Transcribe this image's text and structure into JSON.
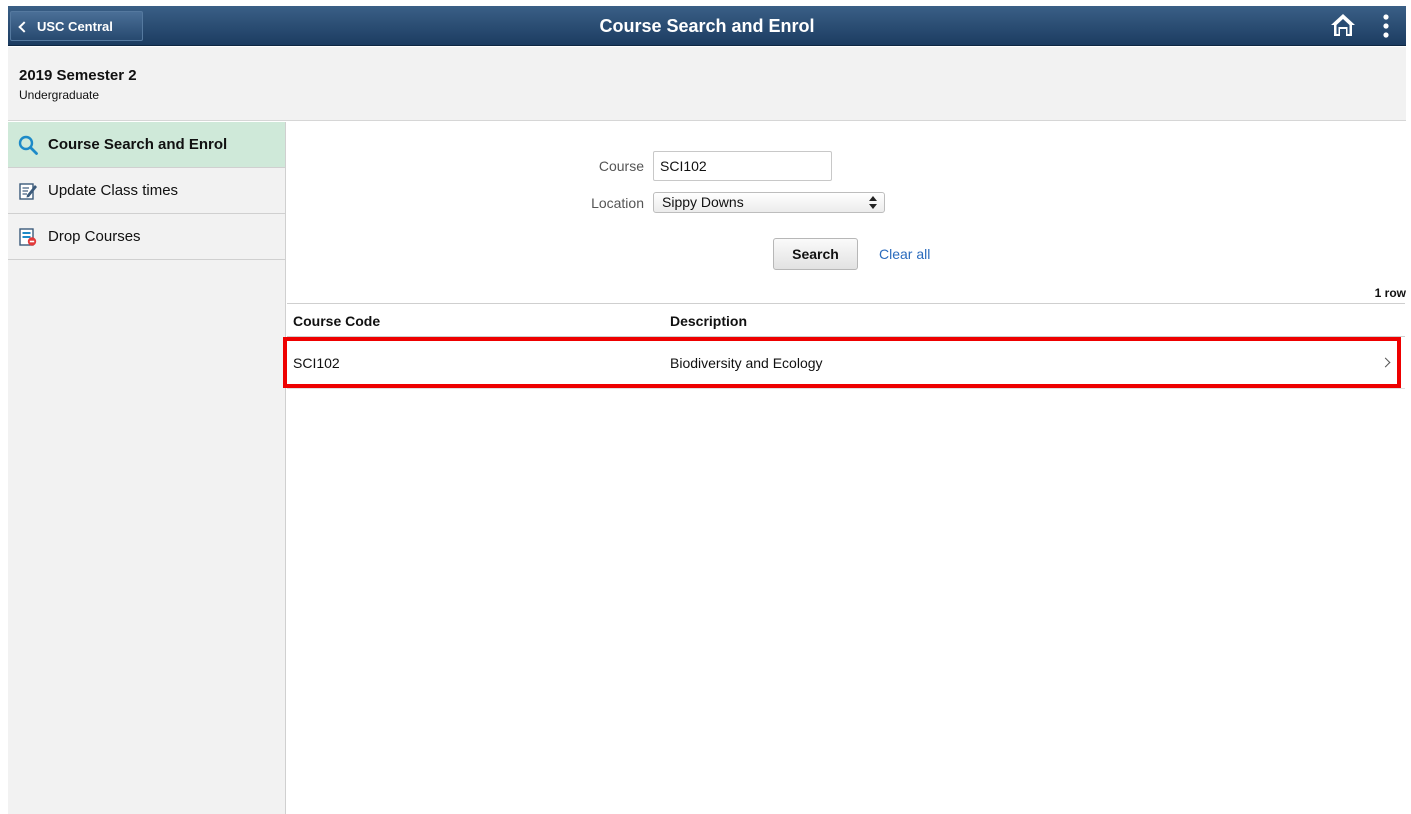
{
  "header": {
    "back_label": "USC Central",
    "title": "Course Search and Enrol",
    "home_icon": "home-icon",
    "more_icon": "more-options-icon",
    "bar_color": "#2a4d74"
  },
  "context": {
    "term": "2019 Semester 2",
    "career": "Undergraduate"
  },
  "sidebar": {
    "items": [
      {
        "label": "Course Search and Enrol",
        "icon": "search-icon",
        "active": true
      },
      {
        "label": "Update Class times",
        "icon": "edit-document-icon",
        "active": false
      },
      {
        "label": "Drop Courses",
        "icon": "drop-document-icon",
        "active": false
      }
    ],
    "active_color": "#cfe9d9"
  },
  "search": {
    "course_label": "Course",
    "course_value": "SCI102",
    "location_label": "Location",
    "location_value": "Sippy Downs",
    "search_button": "Search",
    "clear_link": "Clear all"
  },
  "results": {
    "row_count": "1 row",
    "columns": [
      "Course Code",
      "Description"
    ],
    "rows": [
      {
        "code": "SCI102",
        "description": "Biodiversity and Ecology"
      }
    ],
    "highlight_color": "#ee0000"
  }
}
